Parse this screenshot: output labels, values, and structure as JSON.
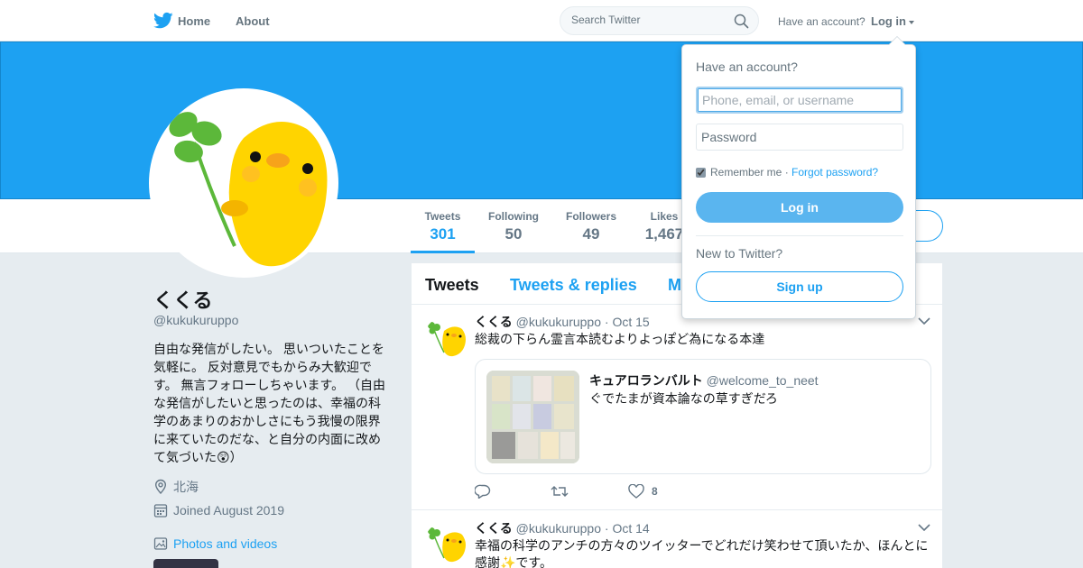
{
  "nav": {
    "home_label": "Home",
    "about_label": "About",
    "search_placeholder": "Search Twitter",
    "have_account": "Have an account?",
    "login_label": "Log in"
  },
  "colors": {
    "brand": "#1da1f2",
    "banner": "#1da1f2",
    "text": "#14171a",
    "muted": "#657786"
  },
  "profile": {
    "name": "くくる",
    "handle": "@kukukuruppo",
    "bio": "自由な発信がしたい。 思いついたことを気軽に。 反対意見でもからみ大歓迎です。 無言フォローしちゃいます。 （自由な発信がしたいと思ったのは、幸福の科学のあまりのおかしさにもう我慢の限界に来ていたのだな、と自分の内面に改めて気づいた😲）",
    "location": "北海",
    "joined": "Joined August 2019",
    "photos_label": "Photos and videos",
    "stats": [
      {
        "label": "Tweets",
        "value": "301"
      },
      {
        "label": "Following",
        "value": "50"
      },
      {
        "label": "Followers",
        "value": "49"
      },
      {
        "label": "Likes",
        "value": "1,467"
      }
    ]
  },
  "timeline": {
    "tabs": [
      "Tweets",
      "Tweets & replies",
      "M"
    ],
    "tweets": [
      {
        "name": "くくる",
        "handle": "@kukukuruppo",
        "separator": "·",
        "date": "Oct 15",
        "text": "総裁の下らん霊言本読むよりよっぽど為になる本達",
        "quote": {
          "name": "キュアロランバルト",
          "handle": "@welcome_to_neet",
          "text": "ぐでたまが資本論なの草すぎだろ"
        },
        "likes": "8"
      },
      {
        "name": "くくる",
        "handle": "@kukukuruppo",
        "separator": "·",
        "date": "Oct 14",
        "text": "幸福の科学のアンチの方々のツイッターでどれだけ笑わせて頂いたか、ほんとに感謝✨です。"
      }
    ]
  },
  "login_dropdown": {
    "title": "Have an account?",
    "username_placeholder": "Phone, email, or username",
    "password_placeholder": "Password",
    "remember_label": "Remember me",
    "separator": "·",
    "forgot_label": "Forgot password?",
    "login_button": "Log in",
    "new_label": "New to Twitter?",
    "signup_button": "Sign up"
  }
}
